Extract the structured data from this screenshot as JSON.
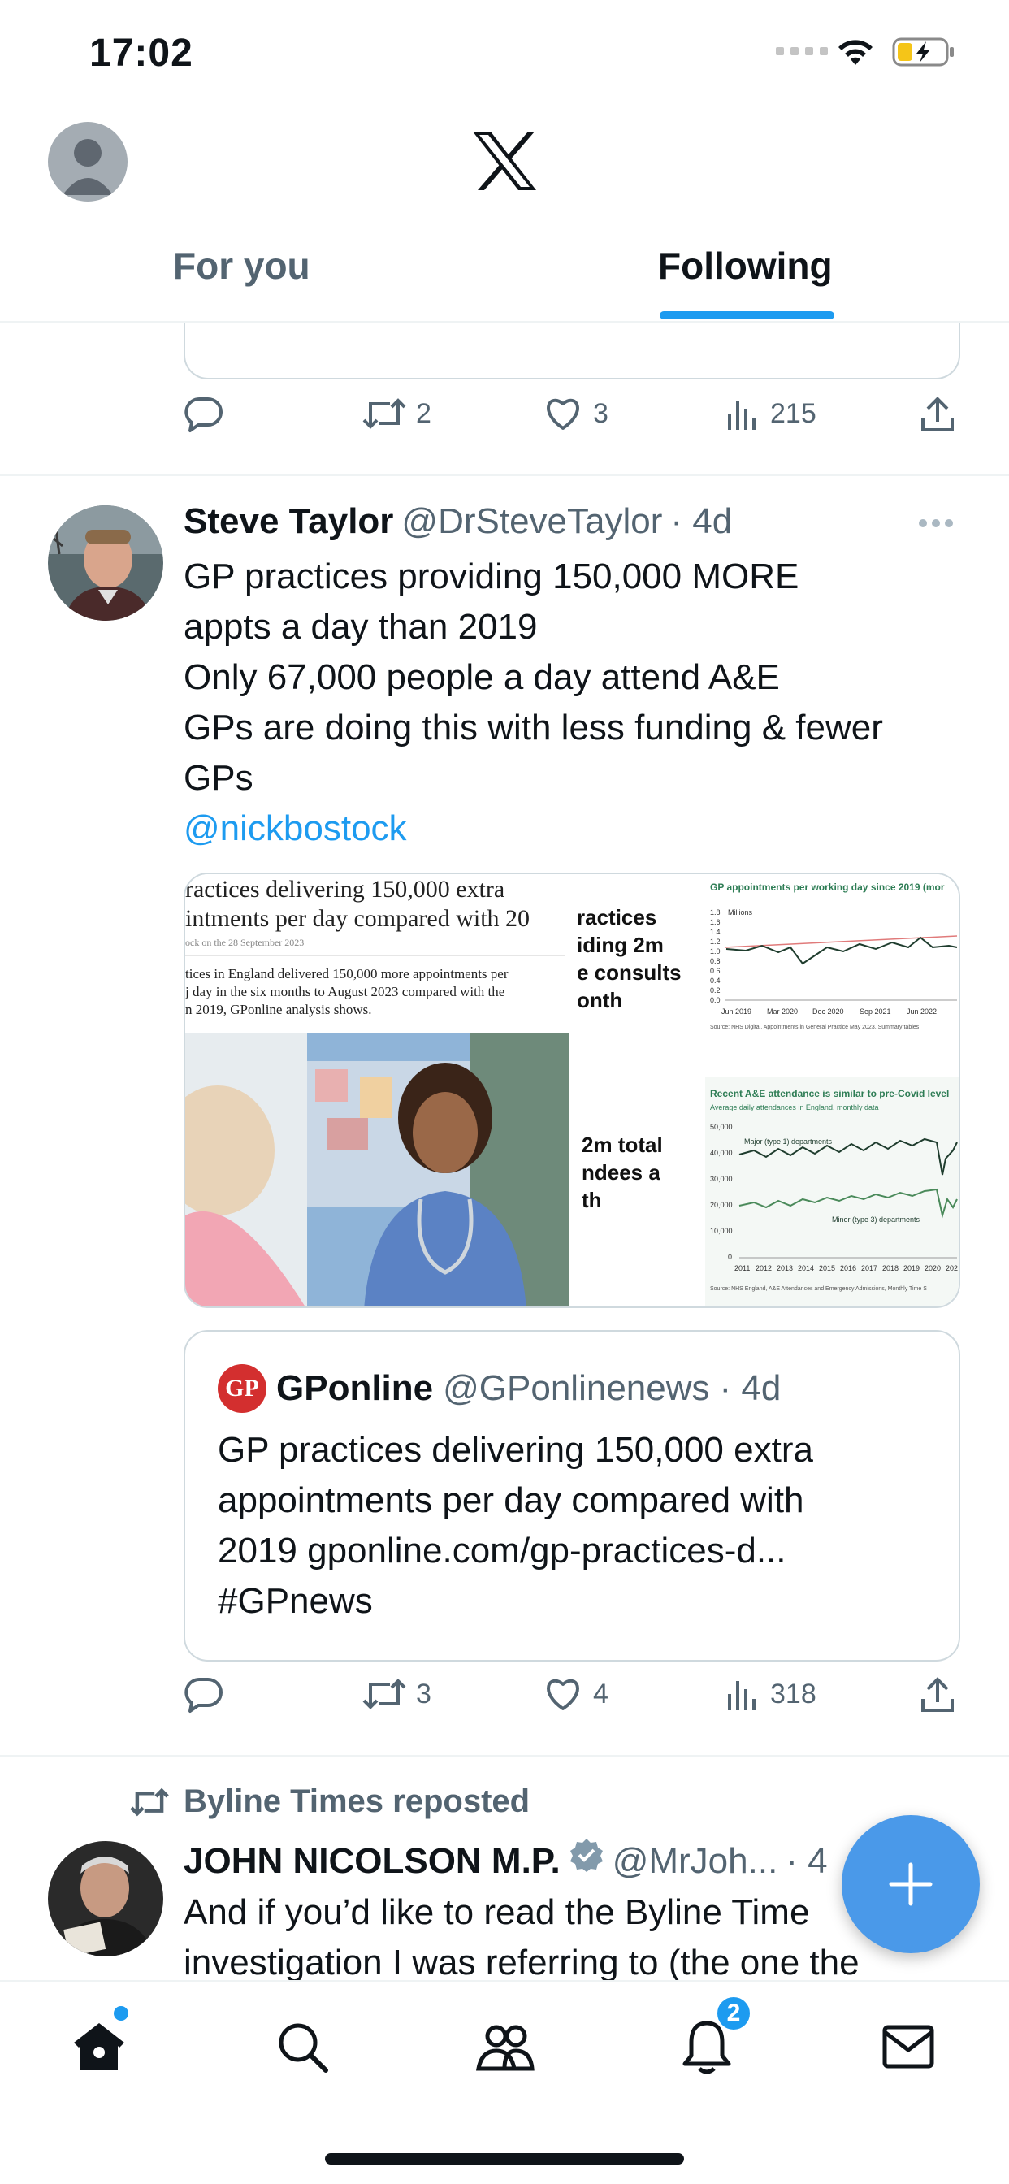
{
  "status_bar": {
    "time": "17:02"
  },
  "header": {
    "tabs": [
      {
        "label": "For you",
        "active": false
      },
      {
        "label": "Following",
        "active": true
      }
    ]
  },
  "previous_tweet": {
    "card_text": "#GPnews",
    "counts": {
      "reply": "",
      "retweets": "2",
      "likes": "3",
      "views": "215"
    }
  },
  "tweet": {
    "name": "Steve Taylor",
    "handle": "@DrSteveTaylor",
    "time": "· 4d",
    "lines": [
      "GP practices providing 150,000 MORE",
      "appts a day than 2019",
      "Only 67,000 people a day attend A&E",
      "GPs are doing this with less funding & fewer",
      "GPs"
    ],
    "mention": "@nickbostock",
    "media": {
      "article_title_1": "ractices delivering 150,000 extra",
      "article_title_2": "intments per day compared with 20",
      "article_meta": "ock on the 28 September 2023",
      "article_text_1": "tices in England delivered 150,000 more appointments per",
      "article_text_2": "j day in the six months to August 2023 compared with the",
      "article_text_3": "n 2019, GPonline analysis shows.",
      "mid_text_1": "ractices",
      "mid_text_2": "iding 2m",
      "mid_text_3": "e consults",
      "mid_text_4": "onth",
      "mid_text_5": "2m total",
      "mid_text_6": "ndees a",
      "mid_text_7": "th",
      "chart1_title": "GP appointments per working day since 2019 (mor",
      "chart1_unit": "Millions",
      "chart1_source": "Source: NHS Digital, Appointments in General Practice May 2023, Summary tables",
      "chart2_title": "Recent A&E attendance is similar to pre-Covid level",
      "chart2_subtitle": "Average daily attendances in England, monthly data",
      "chart2_series_major": "Major (type 1) departments",
      "chart2_series_minor": "Minor (type 3) departments",
      "chart2_source": "Source: NHS England, A&E Attendances and Emergency Admissions, Monthly Time S"
    },
    "quote": {
      "logo": "GP",
      "name": "GPonline",
      "handle": "@GPonlinenews",
      "time": "· 4d",
      "lines": [
        "GP practices delivering 150,000 extra",
        "appointments per day compared with",
        "2019 gponline.com/gp-practices-d...",
        "#GPnews"
      ]
    },
    "counts": {
      "reply": "",
      "retweets": "3",
      "likes": "4",
      "views": "318"
    }
  },
  "next_tweet": {
    "repost_label": "Byline Times reposted",
    "name": "JOHN NICOLSON M.P.",
    "handle": "@MrJoh...",
    "time": "· 4",
    "line1": "And if you’d like to read the Byline Time",
    "line2": "investigation I was referring to (the one the"
  },
  "bottom_nav": {
    "notifications_badge": "2"
  },
  "colors": {
    "accent": "#1d9bf0",
    "text": "#0f1419",
    "secondary": "#536471",
    "border": "#cfd9de"
  }
}
